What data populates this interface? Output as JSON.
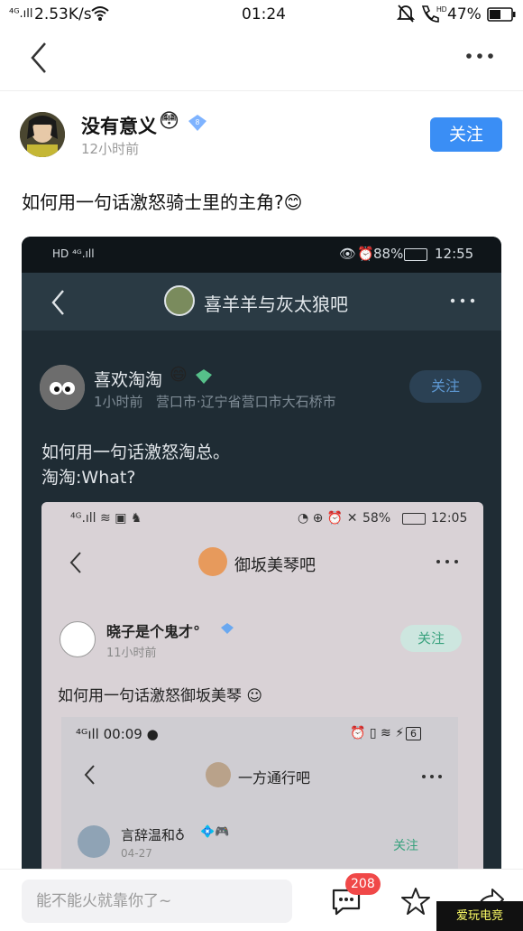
{
  "status_bar": {
    "signal": "⁴ᴳ.ıll",
    "speed": "2.53K/s",
    "time": "01:24",
    "hd_label": "HD",
    "battery": "47%"
  },
  "post": {
    "author_name": "没有意义",
    "author_emoji": "😳",
    "time_ago": "12小时前",
    "follow_label": "关注",
    "title": "如何用一句话激怒骑士里的主角?",
    "title_emoji": "😊"
  },
  "screenshot1": {
    "status": {
      "battery": "88%",
      "time": "12:55"
    },
    "forum_title": "喜羊羊与灰太狼吧",
    "author_name": "喜欢淘淘",
    "author_emoji": "😄",
    "time_location": "1小时前   营口市·辽宁省营口市大石桥市",
    "follow_label": "关注",
    "text_line1": "如何用一句话激怒淘总。",
    "text_line2": "淘淘:What?"
  },
  "screenshot2": {
    "status": {
      "battery": "58%",
      "time": "12:05"
    },
    "forum_title": "御坂美琴吧",
    "author_name": "晓子是个鬼才°",
    "time_ago": "11小时前",
    "follow_label": "关注",
    "text": "如何用一句话激怒御坂美琴"
  },
  "screenshot3": {
    "status_time": "00:09",
    "forum_title": "一方通行吧",
    "author_name": "言辞温和♁",
    "time_ago": "04-27",
    "follow_label": "关注",
    "battery_num": "6"
  },
  "bottom_bar": {
    "comment_placeholder": "能不能火就靠你了~",
    "comment_count": "208"
  },
  "watermark": "爱玩电竞"
}
